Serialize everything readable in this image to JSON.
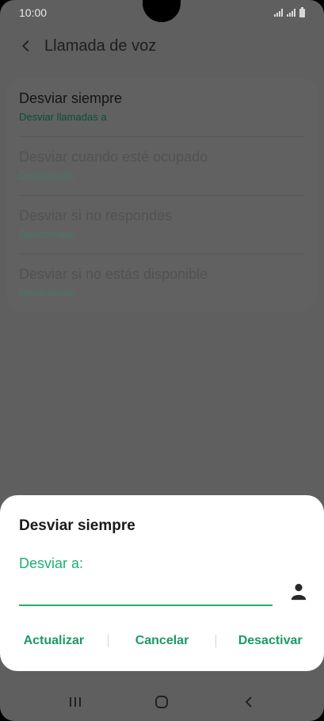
{
  "status_bar": {
    "time": "10:00"
  },
  "header": {
    "title": "Llamada de voz"
  },
  "settings": {
    "items": [
      {
        "title": "Desviar siempre",
        "subtitle": "Desviar llamadas a"
      },
      {
        "title": "Desviar cuando esté ocupado",
        "subtitle": "Desactivado"
      },
      {
        "title": "Desviar si no respondes",
        "subtitle": "Desactivado"
      },
      {
        "title": "Desviar si no estás disponible",
        "subtitle": "Desactivado"
      }
    ]
  },
  "dialog": {
    "title": "Desviar siempre",
    "field_label": "Desviar a:",
    "field_value": "",
    "actions": {
      "update": "Actualizar",
      "cancel": "Cancelar",
      "deactivate": "Desactivar"
    }
  },
  "colors": {
    "accent": "#1fae72",
    "scrim": "#5f5f5f",
    "dialog_bg": "#ffffff"
  },
  "icons": {
    "back": "chevron-left-icon",
    "contact": "person-icon",
    "recents": "recents-icon",
    "home": "home-icon",
    "nav_back": "nav-back-icon"
  }
}
